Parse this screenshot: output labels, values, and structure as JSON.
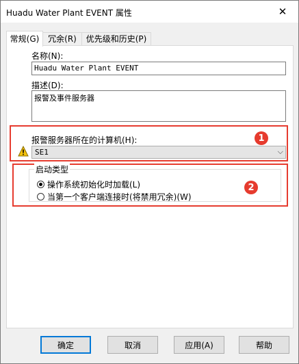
{
  "window": {
    "title": "Huadu Water Plant EVENT 属性",
    "close_glyph": "✕"
  },
  "tabs": [
    {
      "label": "常规(G)",
      "active": true
    },
    {
      "label": "冗余(R)",
      "active": false
    },
    {
      "label": "优先级和历史(P)",
      "active": false
    }
  ],
  "general": {
    "name_label": "名称(N):",
    "name_value": "Huadu Water Plant EVENT",
    "desc_label": "描述(D):",
    "desc_value": "报警及事件服务器",
    "computer_label": "报警服务器所在的计算机(H):",
    "computer_value": "SE1",
    "startup_group_label": "启动类型",
    "startup_options": [
      {
        "label": "操作系统初始化时加载(L)",
        "checked": true
      },
      {
        "label": "当第一个客户端连接时(将禁用冗余)(W)",
        "checked": false
      }
    ]
  },
  "annotations": {
    "badge1": "1",
    "badge2": "2",
    "color": "#e63b2e"
  },
  "icons": {
    "warning": "warning-icon",
    "dropdown": "chevron-down-icon"
  },
  "buttons": {
    "ok": "确定",
    "cancel": "取消",
    "apply": "应用(A)",
    "help": "帮助"
  },
  "colors": {
    "accent": "#0078d7",
    "annotation_red": "#e63b2e",
    "warning_yellow": "#f4c20d"
  }
}
